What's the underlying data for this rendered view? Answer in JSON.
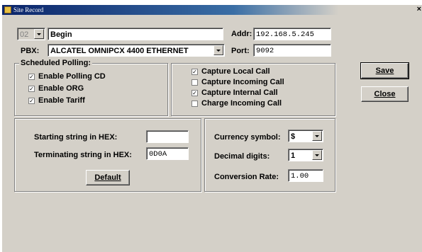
{
  "window": {
    "title": "Site Record",
    "close_glyph": "×"
  },
  "site": {
    "number": "02",
    "name": "Begin",
    "addr_label": "Addr:",
    "addr_value": "192.168.5.245"
  },
  "pbx": {
    "label": "PBX:",
    "value": "ALCATEL OMNIPCX 4400 ETHERNET",
    "port_label": "Port:",
    "port_value": "9092"
  },
  "scheduled_polling": {
    "title": "Scheduled Polling:",
    "items": [
      {
        "label": "Enable Polling CD",
        "checked": true
      },
      {
        "label": "Enable ORG",
        "checked": true
      },
      {
        "label": "Enable Tariff",
        "checked": true
      }
    ]
  },
  "capture": {
    "items": [
      {
        "label": "Capture Local Call",
        "checked": true
      },
      {
        "label": "Capture Incoming Call",
        "checked": false
      },
      {
        "label": "Capture Internal Call",
        "checked": true
      },
      {
        "label": "Charge Incoming Call",
        "checked": false
      }
    ]
  },
  "hex": {
    "start_label": "Starting string in HEX:",
    "start_value": "",
    "term_label": "Terminating string in HEX:",
    "term_value": "0D0A",
    "default_button": "Default"
  },
  "currency": {
    "symbol_label": "Currency symbol:",
    "symbol_value": "$",
    "decimal_label": "Decimal digits:",
    "decimal_value": "1",
    "rate_label": "Conversion Rate:",
    "rate_value": "1.00"
  },
  "actions": {
    "save": "Save",
    "close": "Close"
  },
  "check_glyph": "✓"
}
